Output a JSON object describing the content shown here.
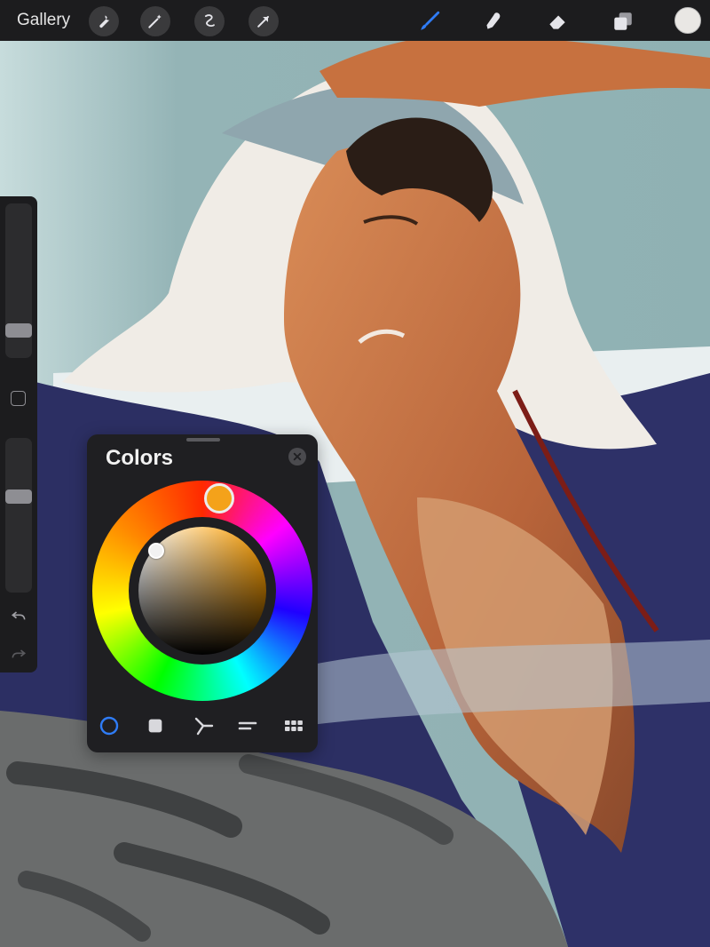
{
  "topbar": {
    "gallery_label": "Gallery",
    "left_tools": [
      "wrench-icon",
      "magic-wand-icon",
      "selection-icon",
      "transform-arrow-icon"
    ],
    "right_tools": [
      "brush-icon",
      "smudge-icon",
      "eraser-icon",
      "layers-icon"
    ],
    "active_tool": "brush-icon",
    "current_color": "#e9e7e4",
    "accent": "#2f7cf6"
  },
  "colors_panel": {
    "title": "Colors",
    "hue_color": "#f4a21a",
    "tabs": [
      "disc-tab",
      "classic-tab",
      "harmony-tab",
      "value-tab",
      "palettes-tab"
    ],
    "active_tab": "disc-tab"
  }
}
